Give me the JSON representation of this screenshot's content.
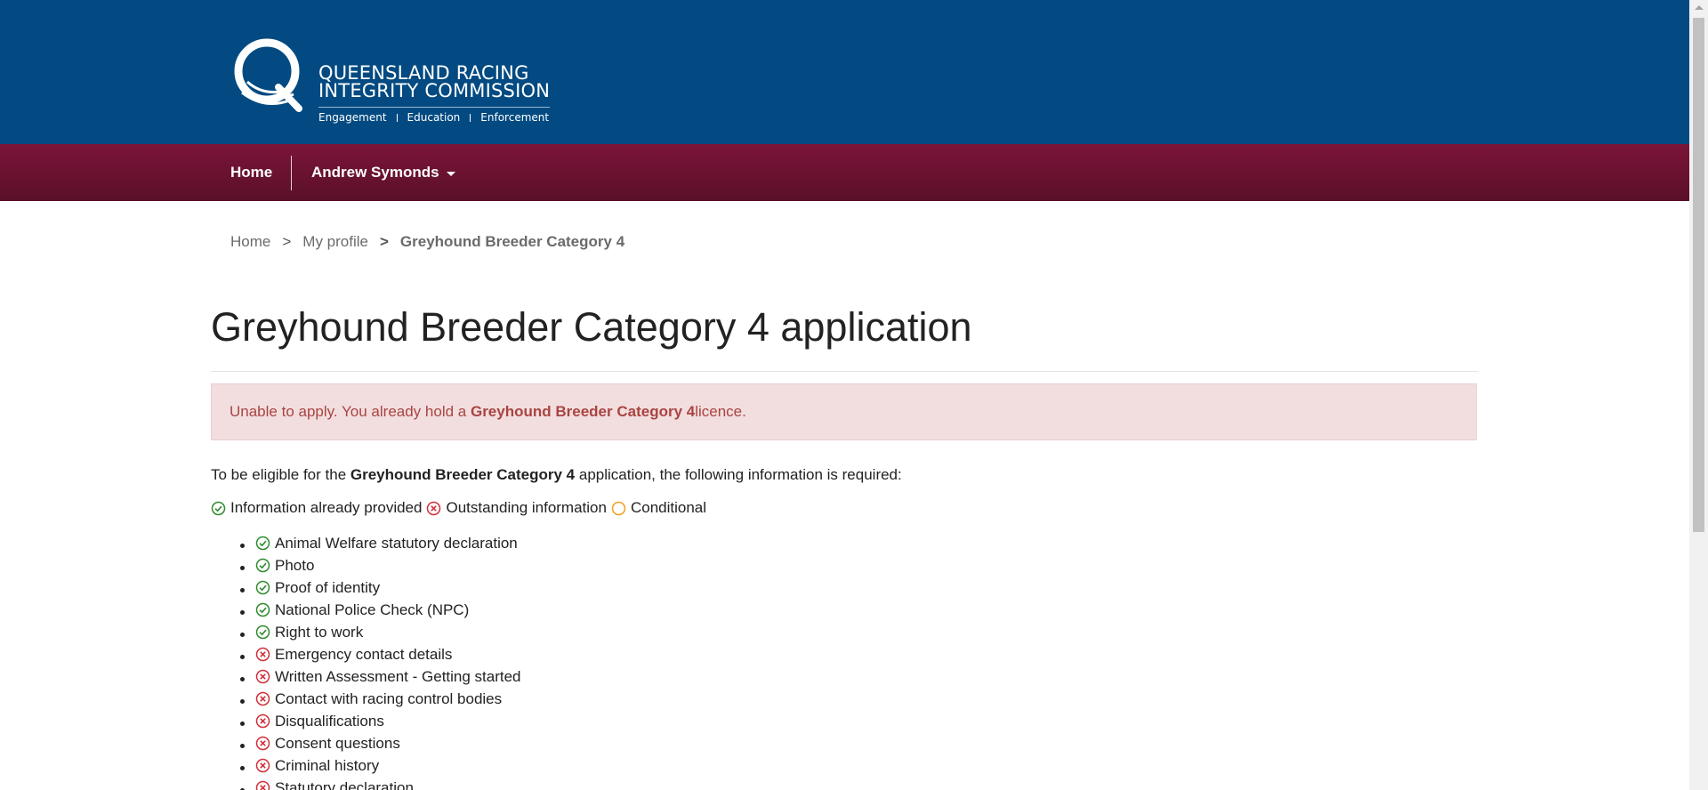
{
  "brand": {
    "line1": "QUEENSLAND RACING",
    "line2": "INTEGRITY COMMISSION",
    "tagline": [
      "Engagement",
      "Education",
      "Enforcement"
    ]
  },
  "nav": {
    "home": "Home",
    "user": "Andrew Symonds"
  },
  "breadcrumb": {
    "home": "Home",
    "profile": "My profile",
    "current": "Greyhound Breeder Category 4",
    "separator": ">"
  },
  "page": {
    "title": "Greyhound Breeder Category 4 application"
  },
  "alert": {
    "prefix": "Unable to apply. You already hold a ",
    "licence": "Greyhound Breeder Category 4",
    "suffix": " licence."
  },
  "intro": {
    "prefix": "To be eligible for the ",
    "licence": "Greyhound Breeder Category 4",
    "suffix": " application, the following information is required:"
  },
  "legend": {
    "provided": "Information already provided",
    "outstanding": "Outstanding information",
    "conditional": "Conditional"
  },
  "colors": {
    "header_blue": "#024a81",
    "nav_maroon": "#7b1439",
    "provided_green": "#2e8b2e",
    "outstanding_red": "#d0303a",
    "conditional_orange": "#f0a020",
    "alert_bg": "#f2dede",
    "alert_text": "#a94442"
  },
  "requirements": [
    {
      "label": "Animal Welfare statutory declaration",
      "status": "provided"
    },
    {
      "label": "Photo",
      "status": "provided"
    },
    {
      "label": "Proof of identity",
      "status": "provided"
    },
    {
      "label": "National Police Check (NPC)",
      "status": "provided"
    },
    {
      "label": "Right to work",
      "status": "provided"
    },
    {
      "label": "Emergency contact details",
      "status": "outstanding"
    },
    {
      "label": "Written Assessment - Getting started",
      "status": "outstanding"
    },
    {
      "label": "Contact with racing control bodies",
      "status": "outstanding"
    },
    {
      "label": "Disqualifications",
      "status": "outstanding"
    },
    {
      "label": "Consent questions",
      "status": "outstanding"
    },
    {
      "label": "Criminal history",
      "status": "outstanding"
    },
    {
      "label": "Statutory declaration",
      "status": "outstanding"
    }
  ]
}
